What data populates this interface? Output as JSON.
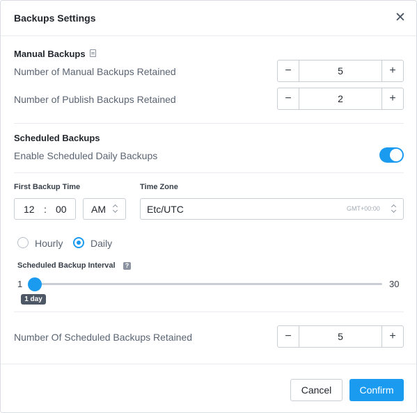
{
  "dialog": {
    "title": "Backups Settings",
    "close_icon": "close-icon"
  },
  "manual": {
    "title": "Manual Backups",
    "manual_retained_label": "Number of Manual Backups Retained",
    "manual_retained_value": "5",
    "publish_retained_label": "Number of Publish Backups Retained",
    "publish_retained_value": "2"
  },
  "scheduled": {
    "title": "Scheduled Backups",
    "enable_label": "Enable Scheduled Daily Backups",
    "enabled": true,
    "first_time_label": "First Backup Time",
    "hour": "12",
    "separator": ":",
    "minute": "00",
    "ampm": "AM",
    "timezone_label": "Time Zone",
    "timezone": "Etc/UTC",
    "timezone_offset": "GMT+00:00",
    "frequency_options": [
      "Hourly",
      "Daily"
    ],
    "frequency_selected": "Daily",
    "interval_label": "Scheduled Backup Interval",
    "help_glyph": "?",
    "interval_min": "1",
    "interval_max": "30",
    "interval_value": 1,
    "interval_tooltip": "1 day",
    "retained_label": "Number Of Scheduled Backups Retained",
    "retained_value": "5"
  },
  "stepper": {
    "minus": "−",
    "plus": "+"
  },
  "footer": {
    "cancel": "Cancel",
    "confirm": "Confirm"
  },
  "colors": {
    "accent": "#1a9bf0",
    "text": "#22272e",
    "muted": "#5a6472",
    "border": "#c9ced5"
  }
}
